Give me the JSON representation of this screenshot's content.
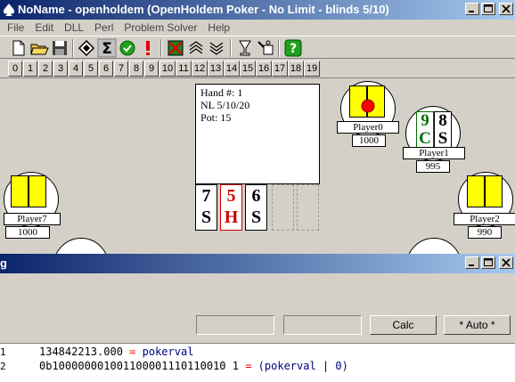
{
  "window": {
    "title": "NoName - openholdem (OpenHoldem Poker - No Limit - blinds 5/10)"
  },
  "menu": [
    "File",
    "Edit",
    "DLL",
    "Perl",
    "Problem Solver",
    "Help"
  ],
  "toolbar": {
    "icons": [
      "new-icon",
      "open-icon",
      "save-icon",
      "formula-icon",
      "sigma-icon",
      "check-icon",
      "exclamation-icon",
      "grid-icon",
      "chevrons-up-icon",
      "chevrons-down-icon",
      "cup-icon",
      "tools-icon",
      "help-icon"
    ]
  },
  "numbers": [
    "0",
    "1",
    "2",
    "3",
    "4",
    "5",
    "6",
    "7",
    "8",
    "9",
    "10",
    "11",
    "12",
    "13",
    "14",
    "15",
    "16",
    "17",
    "18",
    "19"
  ],
  "table": {
    "info_hand": "Hand #: 1",
    "info_game": "NL 5/10/20",
    "info_pot": "Pot: 15",
    "board": [
      {
        "rank": "7",
        "suit": "S",
        "color": "#000000"
      },
      {
        "rank": "5",
        "suit": "H",
        "color": "#d00000"
      },
      {
        "rank": "6",
        "suit": "S",
        "color": "#000000"
      }
    ],
    "players": [
      {
        "name": "Player0",
        "balance": "1000"
      },
      {
        "name": "Player1",
        "balance": "995"
      },
      {
        "name": "Player2",
        "balance": "990"
      },
      {
        "name": "Player7",
        "balance": "1000"
      }
    ],
    "player1_cards": [
      {
        "rank": "9",
        "suit": "C",
        "color": "#007000"
      },
      {
        "rank": "8",
        "suit": "S",
        "color": "#000000"
      }
    ]
  },
  "debug": {
    "title": "g",
    "calc_label": "Calc",
    "auto_label": "* Auto *",
    "lines": [
      {
        "num": "1",
        "value": "134842213.000",
        "eq": "=",
        "expr": "pokerval"
      },
      {
        "num": "2",
        "value": "0b100000001001100001110110010 1",
        "eq": "=",
        "expr": "(pokerval | 0)"
      }
    ]
  }
}
